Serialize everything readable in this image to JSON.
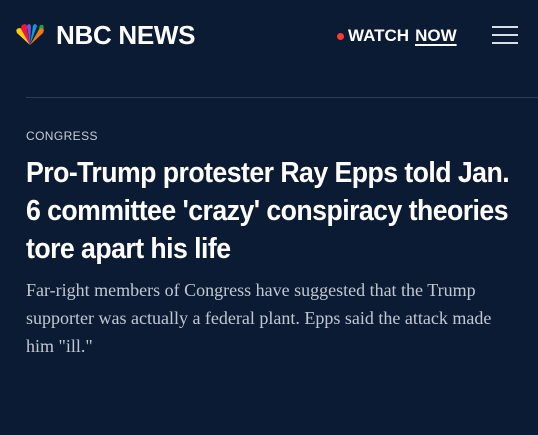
{
  "header": {
    "brand_name": "NBC NEWS",
    "logo_icon": "peacock-icon",
    "watch_label": "WATCH",
    "watch_now_label": "NOW",
    "live_dot_color": "#ff3b30",
    "menu_icon": "hamburger-menu-icon"
  },
  "article": {
    "category": "CONGRESS",
    "headline": "Pro-Trump protester Ray Epps told Jan. 6 committee 'crazy' conspiracy theories tore apart his life",
    "dek": "Far-right members of Congress have suggested that the Trump supporter was actually a federal plant. Epps said the attack made him \"ill.\""
  },
  "colors": {
    "background": "#0b1b34",
    "headline": "#ffffff",
    "dek": "#c2c8d3",
    "category": "#c7ccd6"
  }
}
